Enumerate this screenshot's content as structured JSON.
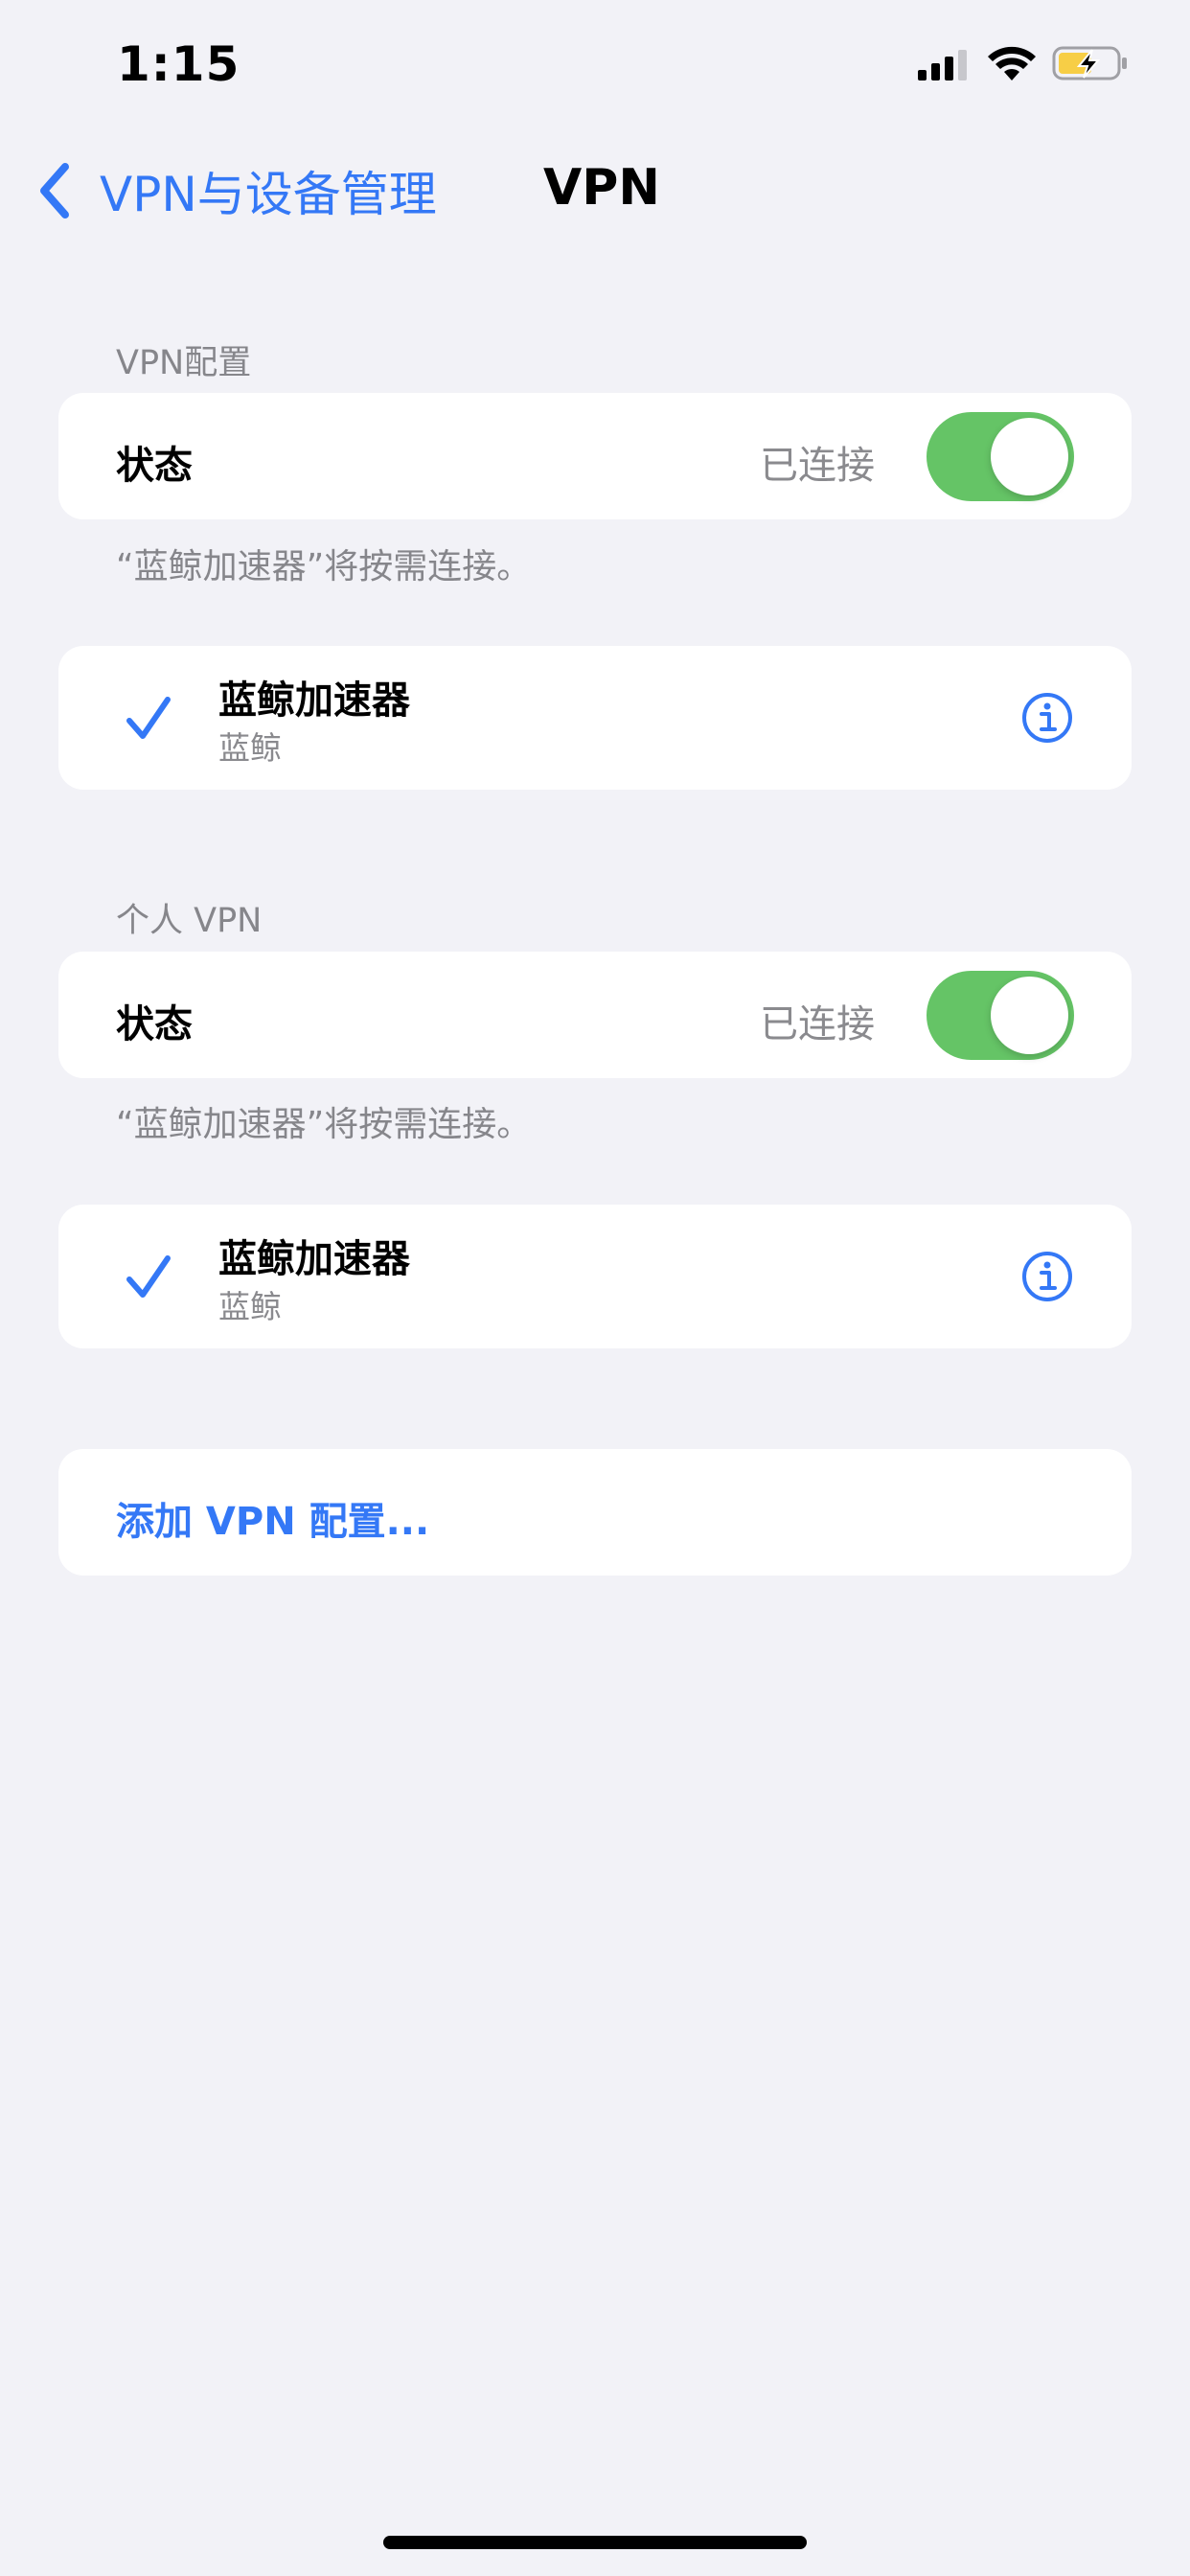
{
  "status_bar": {
    "time": "1:15"
  },
  "nav": {
    "back_label": "VPN与设备管理",
    "title": "VPN"
  },
  "sections": [
    {
      "header": "VPN配置",
      "status_label": "状态",
      "status_value": "已连接",
      "toggle_on": true,
      "footer": "“蓝鲸加速器”将按需连接。",
      "item": {
        "name": "蓝鲸加速器",
        "subtitle": "蓝鲸",
        "selected": true
      }
    },
    {
      "header": "个人 VPN",
      "status_label": "状态",
      "status_value": "已连接",
      "toggle_on": true,
      "footer": "“蓝鲸加速器”将按需连接。",
      "item": {
        "name": "蓝鲸加速器",
        "subtitle": "蓝鲸",
        "selected": true
      }
    }
  ],
  "add_config_label": "添加 VPN 配置...",
  "icons": {
    "back": "chevron-left-icon",
    "check": "checkmark-icon",
    "info": "info-circle-icon",
    "signal": "cellular-signal-icon",
    "wifi": "wifi-icon",
    "battery": "battery-charging-icon"
  },
  "colors": {
    "accent": "#3478f6",
    "toggle_on": "#65c466",
    "background": "#f2f2f7",
    "secondary_text": "#86868b"
  }
}
